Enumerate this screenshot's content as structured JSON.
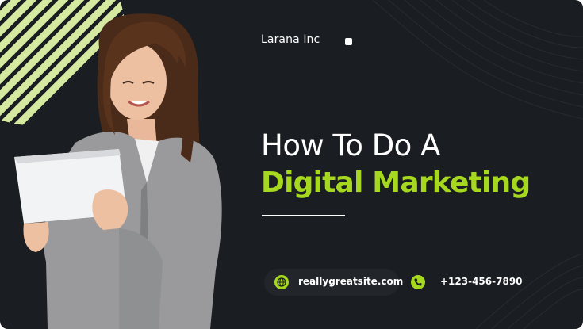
{
  "brand": {
    "company_name": "Larana Inc"
  },
  "headline": {
    "line1": "How To Do A",
    "line2": "Digital Marketing"
  },
  "contact": {
    "website": "reallygreatsite.com",
    "phone": "+123-456-7890"
  },
  "colors": {
    "background": "#1a1d21",
    "accent": "#a6d81f",
    "text": "#ffffff"
  },
  "icons": {
    "website": "globe-icon",
    "phone": "phone-icon"
  }
}
